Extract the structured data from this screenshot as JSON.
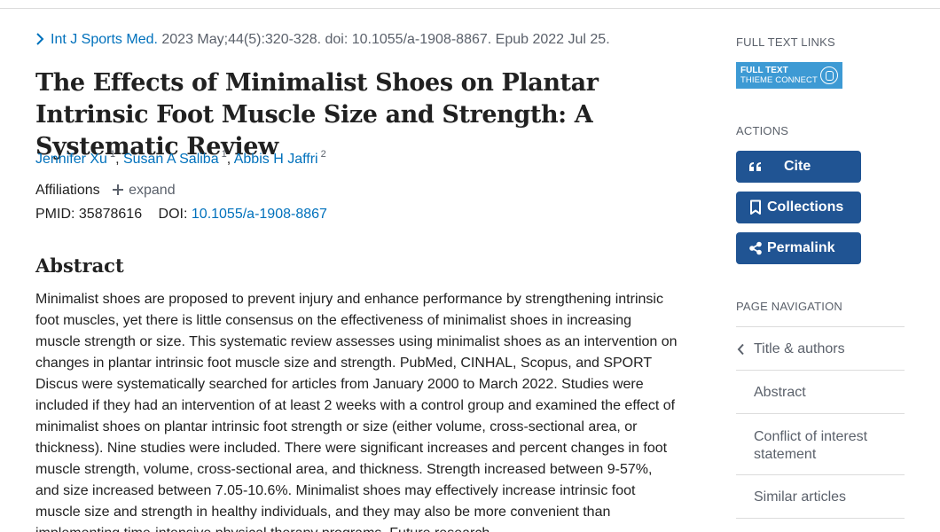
{
  "citation": {
    "journal": "Int J Sports Med.",
    "details": " 2023 May;44(5):320-328. doi: 10.1055/a-1908-8867. Epub 2022 Jul 25."
  },
  "title": "The Effects of Minimalist Shoes on Plantar Intrinsic Foot Muscle Size and Strength: A Systematic Review",
  "authors": [
    {
      "name": "Jennifer Xu",
      "aff": "1"
    },
    {
      "name": "Susan A Saliba",
      "aff": "1"
    },
    {
      "name": "Abbis H Jaffri",
      "aff": "2"
    }
  ],
  "affiliations": {
    "label": "Affiliations",
    "expand_label": "expand"
  },
  "ids": {
    "pmid_label": "PMID:",
    "pmid": "35878616",
    "doi_label": "DOI:",
    "doi": "10.1055/a-1908-8867"
  },
  "abstract": {
    "heading": "Abstract",
    "text": "Minimalist shoes are proposed to prevent injury and enhance performance by strengthening intrinsic foot muscles, yet there is little consensus on the effectiveness of minimalist shoes in increasing muscle strength or size. This systematic review assesses using minimalist shoes as an intervention on changes in plantar intrinsic foot muscle size and strength. PubMed, CINHAL, Scopus, and SPORT Discus were systematically searched for articles from January 2000 to March 2022. Studies were included if they had an intervention of at least 2 weeks with a control group and examined the effect of minimalist shoes on plantar intrinsic foot strength or size (either volume, cross-sectional area, or thickness). Nine studies were included. There were significant increases and percent changes in foot muscle strength, volume, cross-sectional area, and thickness. Strength increased between 9-57%, and size increased between 7.05-10.6%. Minimalist shoes may effectively increase intrinsic foot muscle size and strength in healthy individuals, and they may also be more convenient than implementing time-intensive physical therapy programs. Future research"
  },
  "sidebar": {
    "full_text_heading": "FULL TEXT LINKS",
    "thieme_line1": "FULL TEXT",
    "thieme_line2": "THIEME CONNECT",
    "actions_heading": "ACTIONS",
    "cite_label": "Cite",
    "collections_label": "Collections",
    "permalink_label": "Permalink",
    "page_nav_heading": "PAGE NAVIGATION",
    "page_nav": [
      "Title & authors",
      "Abstract",
      "Conflict of interest statement",
      "Similar articles"
    ]
  },
  "colors": {
    "link": "#0071bc",
    "button": "#205493",
    "thieme": "#3d9ad4",
    "muted": "#5b616b"
  },
  "icons": {
    "citation_chevron": "chevron-right-icon",
    "affiliations_expand": "plus-icon",
    "cite": "quote-icon",
    "collections": "bookmark-icon",
    "permalink": "share-icon",
    "page_nav_chevron": "chevron-left-icon",
    "thieme_logo": "thieme-seal-icon"
  }
}
